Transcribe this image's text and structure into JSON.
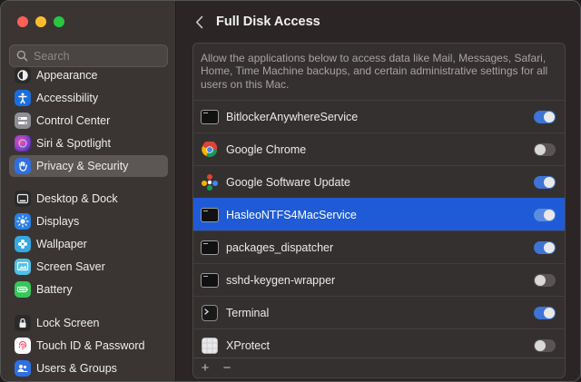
{
  "window": {
    "traffic_lights": {
      "close": "#fe5f57",
      "minimize": "#febc2e",
      "zoom": "#28c840"
    }
  },
  "sidebar": {
    "search_placeholder": "Search",
    "items": [
      {
        "label": "Appearance",
        "icon": "appearance-icon",
        "color": "#2a2a2a"
      },
      {
        "label": "Accessibility",
        "icon": "accessibility-icon",
        "color": "#1a6fe0"
      },
      {
        "label": "Control Center",
        "icon": "control-center-icon",
        "color": "#8e8e93"
      },
      {
        "label": "Siri & Spotlight",
        "icon": "siri-icon",
        "color": "#7a3fd1"
      },
      {
        "label": "Privacy & Security",
        "icon": "hand-icon",
        "color": "#2f6fe4",
        "selected": true
      },
      {
        "label": "Desktop & Dock",
        "icon": "dock-icon",
        "color": "#2a2a2a"
      },
      {
        "label": "Displays",
        "icon": "displays-icon",
        "color": "#2a7fe8"
      },
      {
        "label": "Wallpaper",
        "icon": "wallpaper-icon",
        "color": "#35a8e0"
      },
      {
        "label": "Screen Saver",
        "icon": "screen-saver-icon",
        "color": "#4fc1e9"
      },
      {
        "label": "Battery",
        "icon": "battery-icon",
        "color": "#35c759"
      },
      {
        "label": "Lock Screen",
        "icon": "lock-icon",
        "color": "#2a2a2a"
      },
      {
        "label": "Touch ID & Password",
        "icon": "fingerprint-icon",
        "color": "#ffffff"
      },
      {
        "label": "Users & Groups",
        "icon": "users-icon",
        "color": "#2f6fe4"
      }
    ]
  },
  "main": {
    "title": "Full Disk Access",
    "description": "Allow the applications below to access data like Mail, Messages, Safari, Home, Time Machine backups, and certain administrative settings for all users on this Mac.",
    "apps": [
      {
        "name": "BitlockerAnywhereService",
        "icon": "terminal-icon",
        "enabled": true
      },
      {
        "name": "Google Chrome",
        "icon": "chrome-icon",
        "enabled": false
      },
      {
        "name": "Google Software Update",
        "icon": "google-update-icon",
        "enabled": true
      },
      {
        "name": "HasleoNTFS4MacService",
        "icon": "terminal-icon",
        "enabled": true,
        "selected": true
      },
      {
        "name": "packages_dispatcher",
        "icon": "terminal-icon",
        "enabled": true
      },
      {
        "name": "sshd-keygen-wrapper",
        "icon": "terminal-icon",
        "enabled": false
      },
      {
        "name": "Terminal",
        "icon": "terminal-app-icon",
        "enabled": true
      },
      {
        "name": "XProtect",
        "icon": "xprotect-icon",
        "enabled": false
      }
    ],
    "footer": {
      "add_label": "+",
      "remove_label": "−"
    }
  }
}
